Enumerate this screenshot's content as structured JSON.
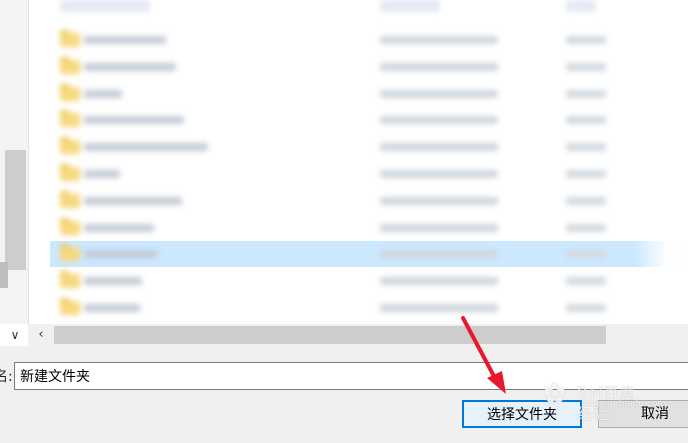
{
  "dialog": {
    "name_label": "名:",
    "folder_name_value": "新建文件夹",
    "select_button_label": "选择文件夹",
    "cancel_button_label": "取消"
  },
  "file_list": {
    "rows": [
      {
        "name": "",
        "selected": false
      },
      {
        "name": "",
        "selected": false
      },
      {
        "name": "",
        "selected": false
      },
      {
        "name": "",
        "selected": false
      },
      {
        "name": "",
        "selected": false
      },
      {
        "name": "",
        "selected": false
      },
      {
        "name": "",
        "selected": false
      },
      {
        "name": "",
        "selected": false
      },
      {
        "name": "",
        "selected": true
      },
      {
        "name": "",
        "selected": false
      },
      {
        "name": "",
        "selected": false
      }
    ]
  },
  "icons": {
    "nav_chevron": "chevron-down-icon",
    "scroll_left": "chevron-left-icon",
    "folder": "folder-icon",
    "annotation": "red-arrow-icon"
  },
  "watermark": {
    "brand": "Bai百度经验",
    "sub": "jingyan.baidu.com"
  },
  "colors": {
    "selection": "#cce8ff",
    "primary_border": "#0078d7",
    "arrow": "#e8192c"
  }
}
